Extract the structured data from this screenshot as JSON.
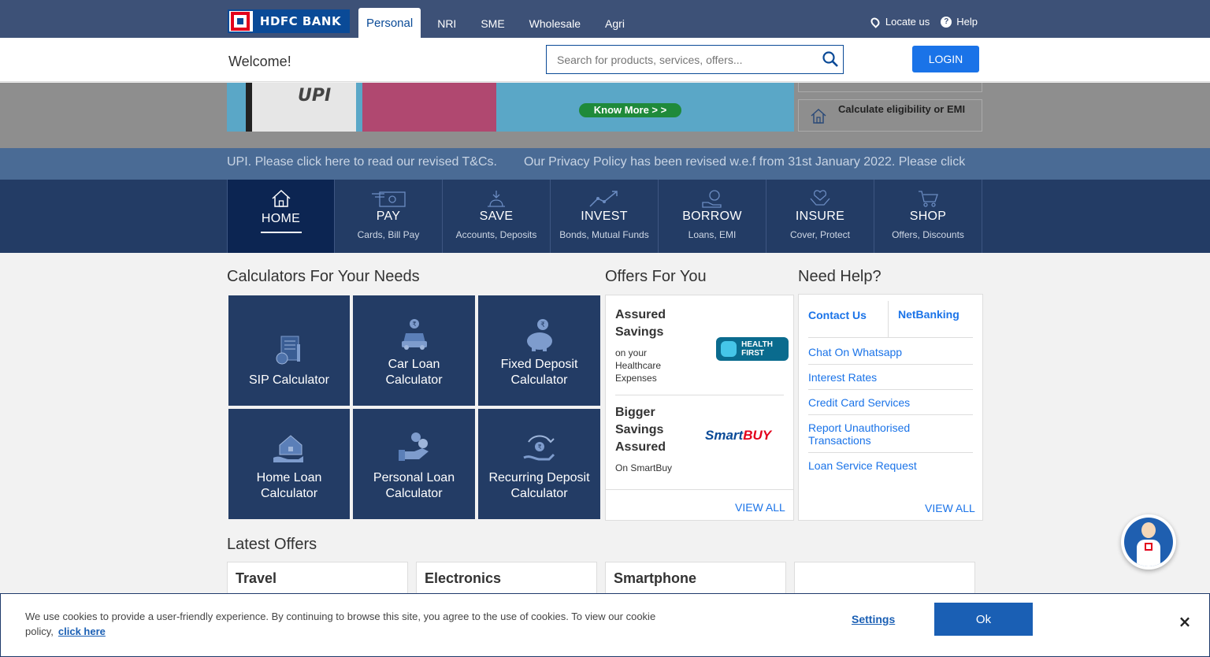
{
  "brand": {
    "name": "HDFC BANK"
  },
  "segments": [
    {
      "label": "Personal",
      "active": true
    },
    {
      "label": "NRI"
    },
    {
      "label": "SME"
    },
    {
      "label": "Wholesale"
    },
    {
      "label": "Agri"
    }
  ],
  "top_links": {
    "locate": "Locate us",
    "help": "Help"
  },
  "header": {
    "welcome": "Welcome!",
    "search_placeholder": "Search for products, services, offers...",
    "login": "LOGIN"
  },
  "banner": {
    "upi": "UPI",
    "know_more": "Know More > >",
    "emi_text": "Calculate eligibility or EMI"
  },
  "ticker": {
    "items": [
      "UPI. Please click here to read our revised T&Cs.",
      "Our Privacy Policy has been revised w.e.f from 31st January 2022. Please click"
    ]
  },
  "nav": [
    {
      "label": "HOME",
      "sub": "",
      "icon": "home-icon",
      "active": true
    },
    {
      "label": "PAY",
      "sub": "Cards, Bill Pay",
      "icon": "pay-icon"
    },
    {
      "label": "SAVE",
      "sub": "Accounts, Deposits",
      "icon": "save-icon"
    },
    {
      "label": "INVEST",
      "sub": "Bonds, Mutual Funds",
      "icon": "invest-icon"
    },
    {
      "label": "BORROW",
      "sub": "Loans, EMI",
      "icon": "borrow-icon"
    },
    {
      "label": "INSURE",
      "sub": "Cover, Protect",
      "icon": "insure-icon"
    },
    {
      "label": "SHOP",
      "sub": "Offers, Discounts",
      "icon": "shop-icon"
    }
  ],
  "calculators": {
    "title": "Calculators For Your Needs",
    "items": [
      {
        "label": "SIP Calculator",
        "icon": "document-chart-icon"
      },
      {
        "label": "Car Loan\nCalculator",
        "icon": "car-icon"
      },
      {
        "label": "Fixed Deposit\nCalculator",
        "icon": "piggy-bank-icon"
      },
      {
        "label": "Home Loan\nCalculator",
        "icon": "house-hand-icon"
      },
      {
        "label": "Personal Loan\nCalculator",
        "icon": "coins-hand-icon"
      },
      {
        "label": "Recurring Deposit\nCalculator",
        "icon": "recurring-icon"
      }
    ]
  },
  "offers": {
    "title": "Offers For You",
    "items": [
      {
        "title": "Assured\nSavings",
        "sub": "on your\nHealthcare\nExpenses",
        "logo": "HEALTH FIRST"
      },
      {
        "title": "Bigger\nSavings\nAssured",
        "sub": "On SmartBuy",
        "logo_a": "Smart",
        "logo_b": "BUY"
      }
    ],
    "view_all": "VIEW ALL"
  },
  "help": {
    "title": "Need Help?",
    "tabs": [
      "Contact Us",
      "NetBanking"
    ],
    "links": [
      "Chat On Whatsapp",
      "Interest Rates",
      "Credit Card Services",
      "Report Unauthorised Transactions",
      "Loan Service Request"
    ],
    "view_all": "VIEW ALL"
  },
  "latest_offers": {
    "title": "Latest Offers",
    "cards": [
      "Travel",
      "Electronics",
      "Smartphone",
      ""
    ]
  },
  "cookie": {
    "text": "We use cookies to provide a user-friendly experience. By continuing to browse this site, you agree to the use of cookies. To view our cookie policy,",
    "link": "click here",
    "settings": "Settings",
    "ok": "Ok",
    "close": "×"
  },
  "colors": {
    "topbar": "#3d5177",
    "nav": "#233c65",
    "nav_active": "#0c2552",
    "link": "#1a73e8",
    "brand_red": "#e3001b"
  }
}
